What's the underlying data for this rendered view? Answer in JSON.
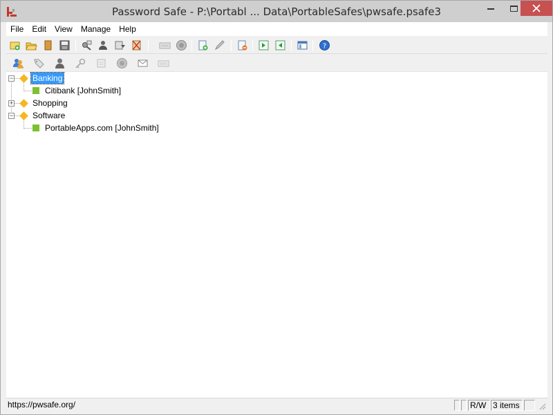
{
  "window": {
    "title": "Password Safe - P:\\Portabl ... Data\\PortableSafes\\pwsafe.psafe3",
    "icons": [
      "app-icon",
      "minimize-icon",
      "maximize-icon",
      "close-icon"
    ]
  },
  "menu": {
    "items": [
      "File",
      "Edit",
      "View",
      "Manage",
      "Help"
    ]
  },
  "toolbar1": {
    "icons": [
      "new-database-icon",
      "open-database-icon",
      "close-database-icon",
      "save-database-icon",
      "copy-password-icon",
      "copy-username-icon",
      "copy-notes-icon",
      "clear-clipboard-icon",
      "autotype-icon",
      "browse-url-icon",
      "add-entry-icon",
      "edit-entry-icon",
      "delete-entry-icon",
      "expand-all-icon",
      "collapse-all-icon",
      "options-icon",
      "help-icon"
    ]
  },
  "toolbar2": {
    "icons": [
      "find-users-icon",
      "tags-icon",
      "user-icon",
      "key-icon",
      "note-icon",
      "globe-icon",
      "email-icon",
      "keyboard-icon"
    ]
  },
  "tree": {
    "groups": [
      {
        "label": "Banking",
        "expanded": true,
        "selected": true,
        "entries": [
          "Citibank [JohnSmith]"
        ]
      },
      {
        "label": "Shopping",
        "expanded": false,
        "selected": false,
        "entries": []
      },
      {
        "label": "Software",
        "expanded": true,
        "selected": false,
        "entries": [
          "PortableApps.com [JohnSmith]"
        ]
      }
    ],
    "expand_glyph": "+",
    "collapse_glyph": "−"
  },
  "status": {
    "url": "https://pwsafe.org/",
    "mode": "R/W",
    "count": "3 items",
    "pane_blank": ""
  },
  "colors": {
    "group": "#f5b720",
    "entry": "#7dc030",
    "selection": "#3399ff",
    "close_button": "#c75050"
  }
}
